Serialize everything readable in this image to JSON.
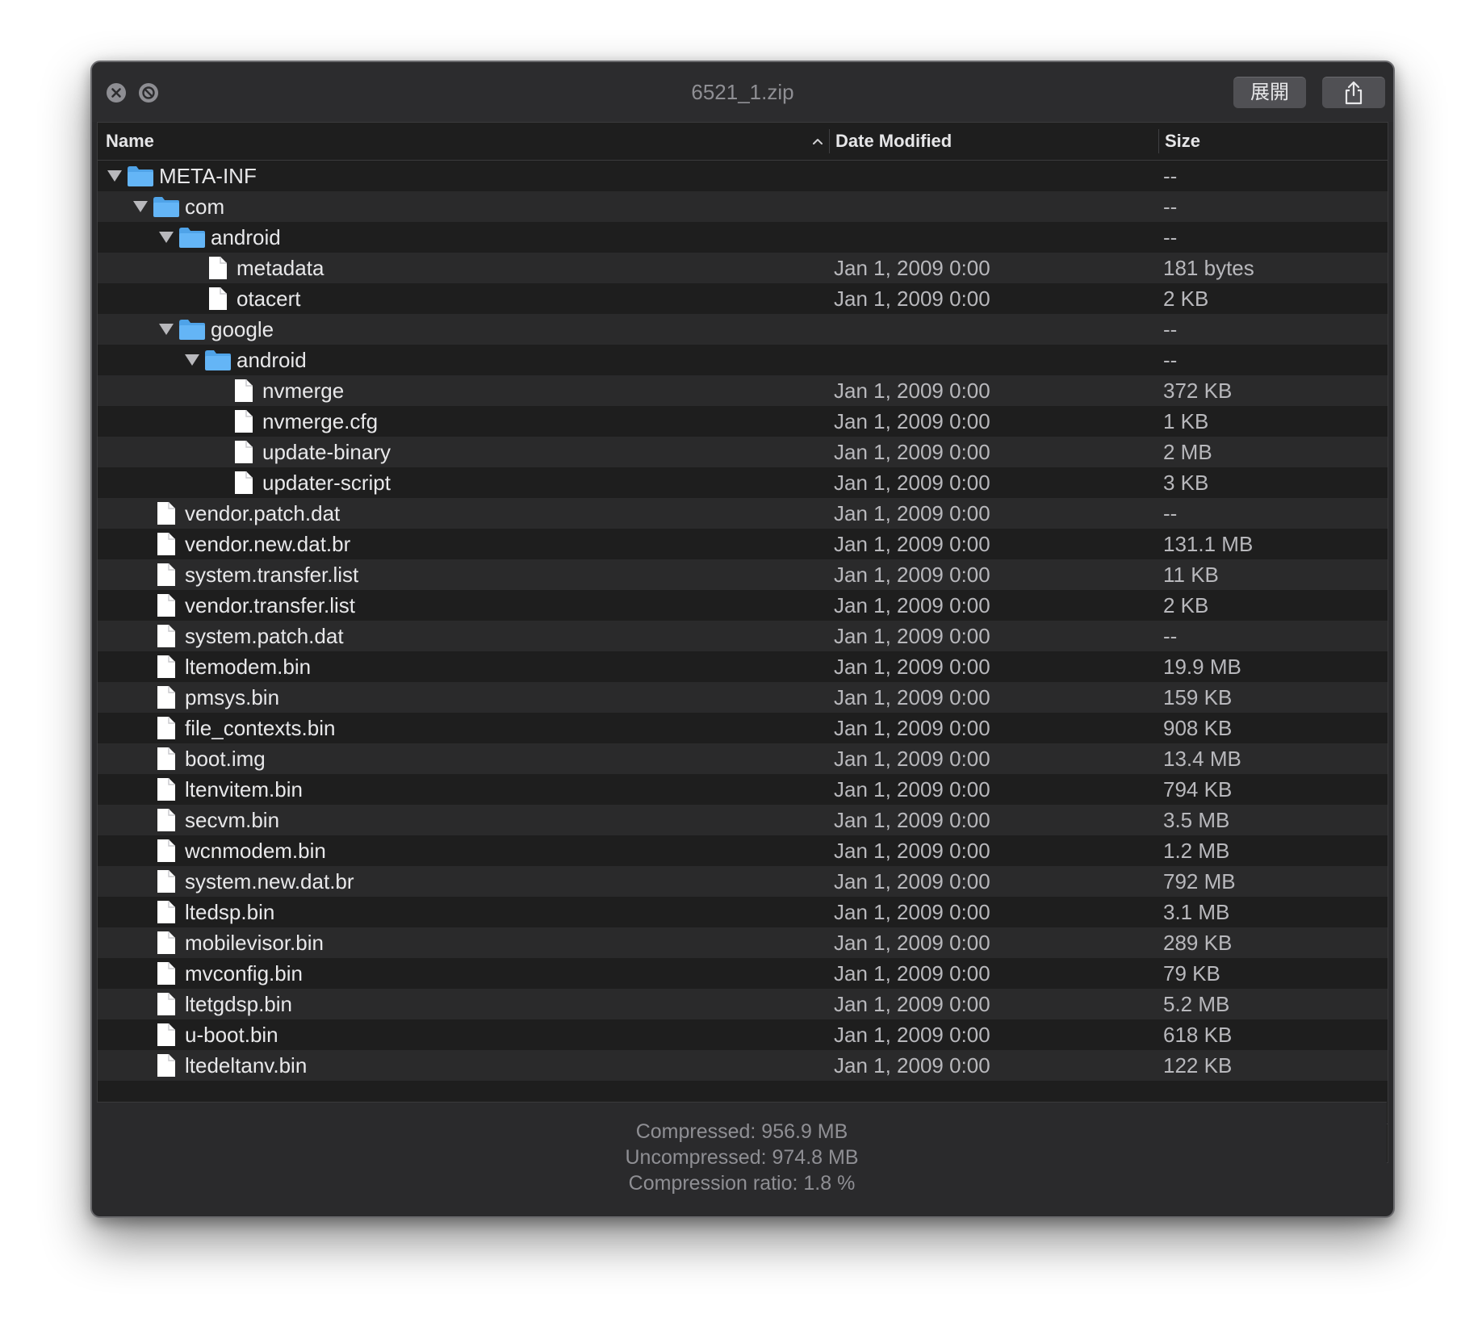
{
  "window": {
    "title": "6521_1.zip",
    "expand_label": "展開"
  },
  "columns": {
    "name": "Name",
    "date": "Date Modified",
    "size": "Size",
    "sort_column": "Name",
    "sort_direction": "ascending"
  },
  "rows": [
    {
      "name": "META-INF",
      "type": "folder",
      "depth": 0,
      "expanded": true,
      "date": "",
      "size": "--"
    },
    {
      "name": "com",
      "type": "folder",
      "depth": 1,
      "expanded": true,
      "date": "",
      "size": "--"
    },
    {
      "name": "android",
      "type": "folder",
      "depth": 2,
      "expanded": true,
      "date": "",
      "size": "--"
    },
    {
      "name": "metadata",
      "type": "file",
      "depth": 3,
      "date": "Jan 1, 2009 0:00",
      "size": "181 bytes"
    },
    {
      "name": "otacert",
      "type": "file",
      "depth": 3,
      "date": "Jan 1, 2009 0:00",
      "size": "2 KB"
    },
    {
      "name": "google",
      "type": "folder",
      "depth": 2,
      "expanded": true,
      "date": "",
      "size": "--"
    },
    {
      "name": "android",
      "type": "folder",
      "depth": 3,
      "expanded": true,
      "date": "",
      "size": "--"
    },
    {
      "name": "nvmerge",
      "type": "file",
      "depth": 4,
      "date": "Jan 1, 2009 0:00",
      "size": "372 KB"
    },
    {
      "name": "nvmerge.cfg",
      "type": "file",
      "depth": 4,
      "date": "Jan 1, 2009 0:00",
      "size": "1 KB"
    },
    {
      "name": "update-binary",
      "type": "file",
      "depth": 4,
      "date": "Jan 1, 2009 0:00",
      "size": "2 MB"
    },
    {
      "name": "updater-script",
      "type": "file",
      "depth": 4,
      "date": "Jan 1, 2009 0:00",
      "size": "3 KB"
    },
    {
      "name": "vendor.patch.dat",
      "type": "file",
      "depth": 1,
      "date": "Jan 1, 2009 0:00",
      "size": "--"
    },
    {
      "name": "vendor.new.dat.br",
      "type": "file",
      "depth": 1,
      "date": "Jan 1, 2009 0:00",
      "size": "131.1 MB"
    },
    {
      "name": "system.transfer.list",
      "type": "file",
      "depth": 1,
      "date": "Jan 1, 2009 0:00",
      "size": "11 KB"
    },
    {
      "name": "vendor.transfer.list",
      "type": "file",
      "depth": 1,
      "date": "Jan 1, 2009 0:00",
      "size": "2 KB"
    },
    {
      "name": "system.patch.dat",
      "type": "file",
      "depth": 1,
      "date": "Jan 1, 2009 0:00",
      "size": "--"
    },
    {
      "name": "ltemodem.bin",
      "type": "file",
      "depth": 1,
      "date": "Jan 1, 2009 0:00",
      "size": "19.9 MB"
    },
    {
      "name": "pmsys.bin",
      "type": "file",
      "depth": 1,
      "date": "Jan 1, 2009 0:00",
      "size": "159 KB"
    },
    {
      "name": "file_contexts.bin",
      "type": "file",
      "depth": 1,
      "date": "Jan 1, 2009 0:00",
      "size": "908 KB"
    },
    {
      "name": "boot.img",
      "type": "file",
      "depth": 1,
      "date": "Jan 1, 2009 0:00",
      "size": "13.4 MB"
    },
    {
      "name": "ltenvitem.bin",
      "type": "file",
      "depth": 1,
      "date": "Jan 1, 2009 0:00",
      "size": "794 KB"
    },
    {
      "name": "secvm.bin",
      "type": "file",
      "depth": 1,
      "date": "Jan 1, 2009 0:00",
      "size": "3.5 MB"
    },
    {
      "name": "wcnmodem.bin",
      "type": "file",
      "depth": 1,
      "date": "Jan 1, 2009 0:00",
      "size": "1.2 MB"
    },
    {
      "name": "system.new.dat.br",
      "type": "file",
      "depth": 1,
      "date": "Jan 1, 2009 0:00",
      "size": "792 MB"
    },
    {
      "name": "ltedsp.bin",
      "type": "file",
      "depth": 1,
      "date": "Jan 1, 2009 0:00",
      "size": "3.1 MB"
    },
    {
      "name": "mobilevisor.bin",
      "type": "file",
      "depth": 1,
      "date": "Jan 1, 2009 0:00",
      "size": "289 KB"
    },
    {
      "name": "mvconfig.bin",
      "type": "file",
      "depth": 1,
      "date": "Jan 1, 2009 0:00",
      "size": "79 KB"
    },
    {
      "name": "ltetgdsp.bin",
      "type": "file",
      "depth": 1,
      "date": "Jan 1, 2009 0:00",
      "size": "5.2 MB"
    },
    {
      "name": "u-boot.bin",
      "type": "file",
      "depth": 1,
      "date": "Jan 1, 2009 0:00",
      "size": "618 KB"
    },
    {
      "name": "ltedeltanv.bin",
      "type": "file",
      "depth": 1,
      "date": "Jan 1, 2009 0:00",
      "size": "122 KB"
    }
  ],
  "footer": {
    "compressed": "Compressed: 956.9 MB",
    "uncompressed": "Uncompressed: 974.8 MB",
    "ratio": "Compression ratio: 1.8 %"
  },
  "icons": {
    "close": "close-icon",
    "stop": "stop-icon",
    "share": "share-icon",
    "folder": "folder-icon",
    "file": "file-icon",
    "sort": "chevron-up-icon"
  },
  "colors": {
    "folder": "#64b5f6",
    "window_bg": "#2a2a2c",
    "row_even": "#2a2a2b",
    "row_odd": "#1e1e1e"
  }
}
